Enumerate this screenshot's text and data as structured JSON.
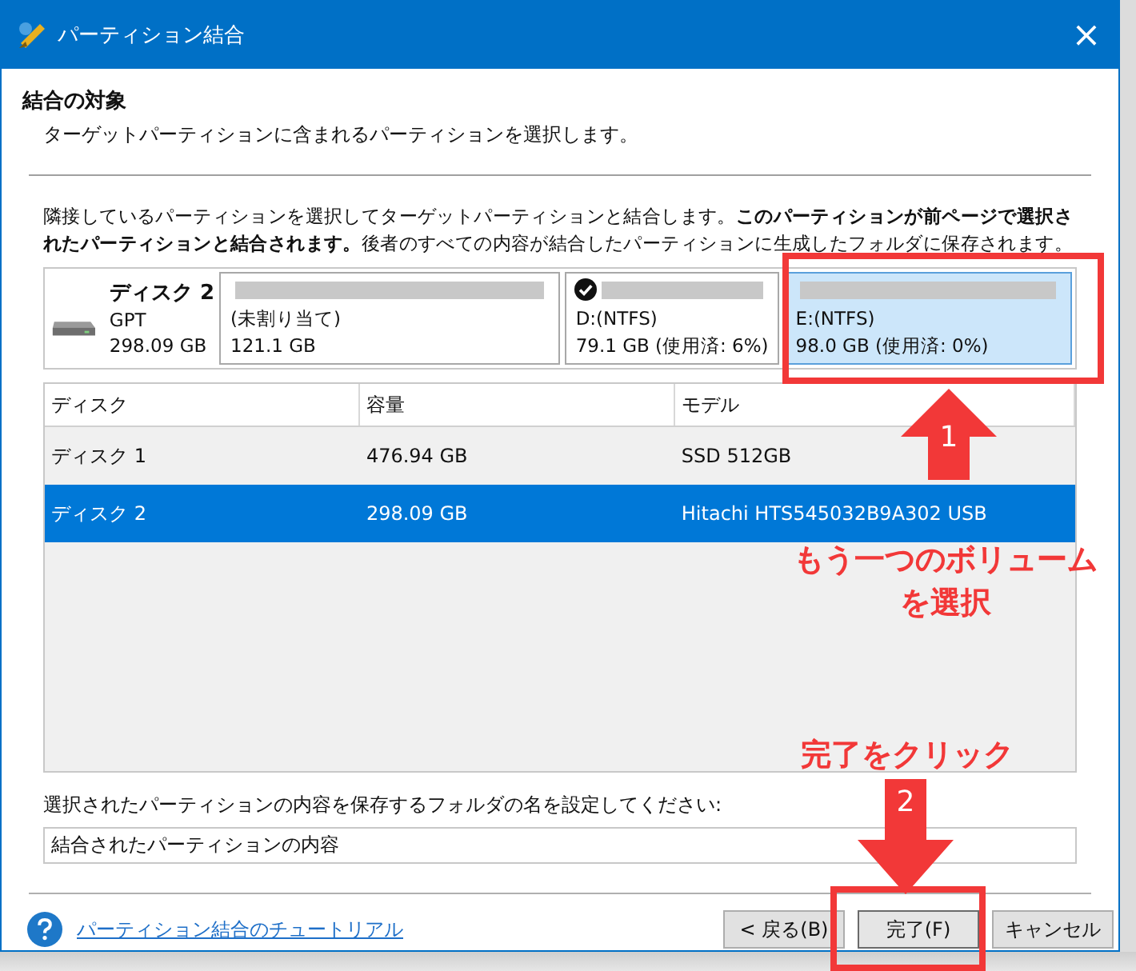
{
  "window": {
    "title": "パーティション結合",
    "close": "×"
  },
  "header": {
    "title": "結合の対象",
    "subtitle": "ターゲットパーティションに含まれるパーティションを選択します。"
  },
  "description": "隣接しているパーティションを選択してターゲットパーティションと結合します。**このパーティションが前ページで選択されたパーティションと結合されます。**後者のすべての内容が結合したパーティションに生成したフォルダに保存されます。",
  "disk": {
    "name": "ディスク 2",
    "style": "GPT",
    "size": "298.09 GB"
  },
  "partitions": [
    {
      "label": "(未割り当て)",
      "info": "121.1 GB",
      "checked": false,
      "selected": false
    },
    {
      "label": "D:(NTFS)",
      "info": "79.1 GB (使用済: 6%)",
      "checked": true,
      "selected": false
    },
    {
      "label": "E:(NTFS)",
      "info": "98.0 GB (使用済: 0%)",
      "checked": false,
      "selected": true
    }
  ],
  "table": {
    "columns": [
      "ディスク",
      "容量",
      "モデル"
    ],
    "rows": [
      {
        "cells": [
          "ディスク 1",
          "476.94 GB",
          "SSD 512GB"
        ],
        "selected": false
      },
      {
        "cells": [
          "ディスク 2",
          "298.09 GB",
          "Hitachi HTS545032B9A302 USB"
        ],
        "selected": true
      }
    ]
  },
  "folder": {
    "label": "選択されたパーティションの内容を保存するフォルダの名を設定してください:",
    "value": "結合されたパーティションの内容"
  },
  "help_link": "パーティション結合のチュートリアル",
  "buttons": [
    {
      "label": "< 戻る(B)",
      "default": false
    },
    {
      "label": "完了(F)",
      "default": true
    },
    {
      "label": "キャンセル",
      "default": false
    }
  ],
  "annotations": [
    {
      "kind": "box"
    },
    {
      "kind": "uparrow",
      "number": "1"
    },
    {
      "kind": "note",
      "text": "もう一つのボリュームを選択"
    },
    {
      "kind": "note",
      "text": "完了をクリック"
    },
    {
      "kind": "downarrow",
      "number": "2"
    },
    {
      "kind": "box"
    }
  ]
}
